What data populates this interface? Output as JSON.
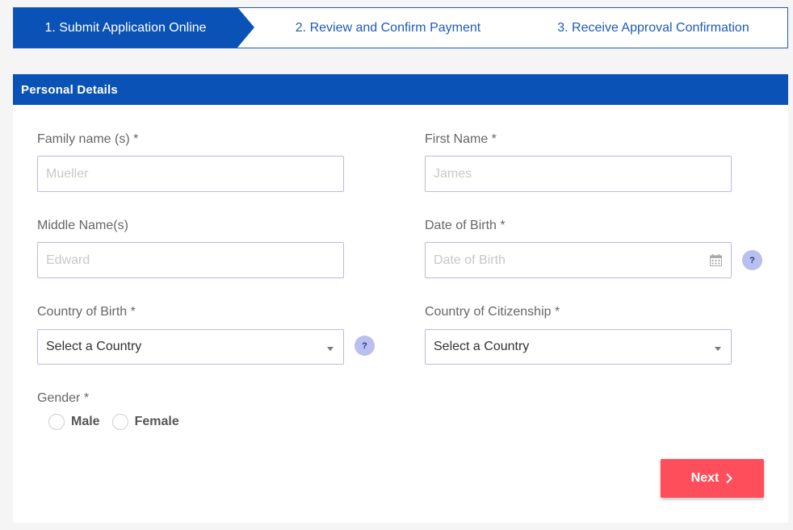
{
  "steps": [
    {
      "label": "1. Submit Application Online",
      "active": true
    },
    {
      "label": "2. Review and Confirm Payment",
      "active": false
    },
    {
      "label": "3. Receive Approval Confirmation",
      "active": false
    }
  ],
  "panel": {
    "title": "Personal Details"
  },
  "form": {
    "family_name": {
      "label": "Family name (s) *",
      "placeholder": "Mueller"
    },
    "first_name": {
      "label": "First Name *",
      "placeholder": "James"
    },
    "middle_name": {
      "label": "Middle Name(s)",
      "placeholder": "Edward"
    },
    "dob": {
      "label": "Date of Birth *",
      "placeholder": "Date of Birth",
      "icon": "calendar-icon"
    },
    "country_of_birth": {
      "label": "Country of Birth *",
      "value": "Select a Country"
    },
    "country_of_citizenship": {
      "label": "Country of Citizenship *",
      "value": "Select a Country"
    },
    "help_text": "?",
    "gender": {
      "label": "Gender *",
      "options": [
        "Male",
        "Female"
      ]
    }
  },
  "actions": {
    "next_label": "Next",
    "next_icon": "chevron-right-icon"
  },
  "colors": {
    "primary": "#0a52b5",
    "accent": "#ff4e5b",
    "help": "#b9bfee",
    "border": "#b9b9e8"
  }
}
